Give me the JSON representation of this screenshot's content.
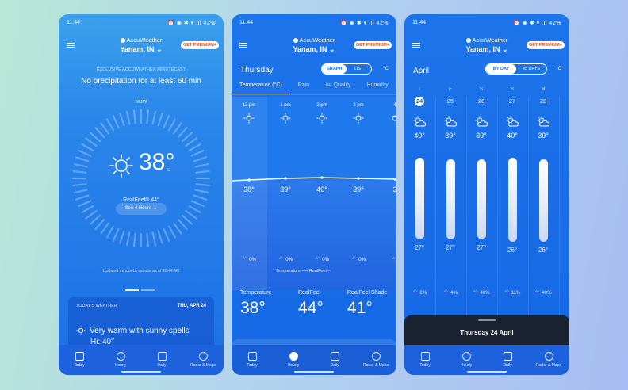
{
  "status": {
    "time": "11:44",
    "icons": "⏰ ◉ ✱ ▾ .ıl 42%"
  },
  "brand": {
    "name": "AccuWeather",
    "location": "Yanam, IN",
    "premium": "GET PREMIUM+"
  },
  "nav": [
    {
      "label": "Today",
      "icon": "calendar-icon"
    },
    {
      "label": "Hourly",
      "icon": "clock-icon"
    },
    {
      "label": "Daily",
      "icon": "calendar-grid-icon"
    },
    {
      "label": "Radar & Maps",
      "icon": "radar-icon"
    }
  ],
  "today": {
    "exclusive": "EXCLUSIVE ACCUWEATHER MINUTECAST",
    "precip": "No precipitation for at least 60 min",
    "now": "NOW",
    "temp": "38°",
    "unit": "C",
    "realfeel": "RealFeel® 44°",
    "see_hours": "See 4 Hours →",
    "updated": "Updated minute-by-minute as of 11:44 AM",
    "card_title": "TODAY'S WEATHER",
    "card_date": "THU, APR 24",
    "condition": "Very warm with sunny spells",
    "hi": "Hi: 40°"
  },
  "hourly": {
    "day": "Thursday",
    "toggle": [
      "GRAPH",
      "LIST"
    ],
    "unit": "°C",
    "tabs": [
      "Temperature (°C)",
      "Rain",
      "Air Quality",
      "Humidity"
    ],
    "hours": [
      {
        "time": "12 pm",
        "temp": "38°",
        "precip": "☔ 0%"
      },
      {
        "time": "1 pm",
        "temp": "39°",
        "precip": "☔ 0%"
      },
      {
        "time": "2 pm",
        "temp": "40°",
        "precip": "☔ 0%"
      },
      {
        "time": "3 pm",
        "temp": "39°",
        "precip": "☔ 0%"
      },
      {
        "time": "4",
        "temp": "3",
        "precip": "☔"
      }
    ],
    "legend": "Temperature ⟶ RealFeel --",
    "stats": [
      {
        "label": "Temperature",
        "value": "38°"
      },
      {
        "label": "RealFeel",
        "value": "44°"
      },
      {
        "label": "RealFeel Shade",
        "value": "41°"
      }
    ]
  },
  "daily": {
    "month": "April",
    "toggle": [
      "BY DAY",
      "45 DAYS"
    ],
    "unit": "°C",
    "days": [
      {
        "dow": "T",
        "date": "24",
        "hi": "40°",
        "lo": "27°",
        "precip": "☔ 2%",
        "hi_val": 40,
        "lo_val": 27
      },
      {
        "dow": "F",
        "date": "25",
        "hi": "39°",
        "lo": "27°",
        "precip": "☔ 4%",
        "hi_val": 39,
        "lo_val": 27
      },
      {
        "dow": "S",
        "date": "26",
        "hi": "39°",
        "lo": "27°",
        "precip": "☔ 40%",
        "hi_val": 39,
        "lo_val": 27
      },
      {
        "dow": "S",
        "date": "27",
        "hi": "40°",
        "lo": "26°",
        "precip": "☔ 11%",
        "hi_val": 40,
        "lo_val": 26
      },
      {
        "dow": "M",
        "date": "28",
        "hi": "39°",
        "lo": "26°",
        "precip": "☔ 40%",
        "hi_val": 39,
        "lo_val": 26
      }
    ],
    "sheet_title": "Thursday 24 April"
  }
}
